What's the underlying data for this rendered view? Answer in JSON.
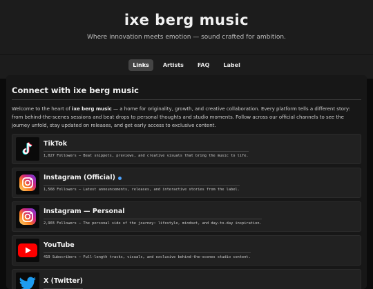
{
  "header": {
    "title": "ixe berg music",
    "tagline": "Where innovation meets emotion — sound crafted for ambition."
  },
  "nav": {
    "items": [
      {
        "label": "Links",
        "active": true
      },
      {
        "label": "Artists",
        "active": false
      },
      {
        "label": "FAQ",
        "active": false
      },
      {
        "label": "Label",
        "active": false
      }
    ]
  },
  "main": {
    "title": "Connect with ixe berg music",
    "intro_prefix": "Welcome to the heart of ",
    "intro_bold": "ixe berg music",
    "intro_rest": " — a home for originality, growth, and creative collaboration. Every platform tells a different story: from behind-the-scenes sessions and beat drops to personal thoughts and studio moments. Follow across our official channels to see the journey unfold, stay updated on releases, and get early access to exclusive content.",
    "links": [
      {
        "name": "TikTok",
        "icon": "tiktok-icon",
        "verified": false,
        "desc": "1,027 Followers — Beat snippets, previews, and creative visuals that bring the music to life."
      },
      {
        "name": "Instagram (Official)",
        "icon": "instagram-icon",
        "verified": true,
        "desc": "1,568 Followers — Latest announcements, releases, and interactive stories from the label."
      },
      {
        "name": "Instagram — Personal",
        "icon": "instagram-icon",
        "verified": false,
        "desc": "2,903 Followers — The personal side of the journey: lifestyle, mindset, and day-to-day inspiration."
      },
      {
        "name": "YouTube",
        "icon": "youtube-icon",
        "verified": false,
        "desc": "419 Subscribers — Full-length tracks, visuals, and exclusive behind-the-scenes studio content."
      },
      {
        "name": "X (Twitter)",
        "icon": "twitter-icon",
        "verified": false,
        "desc": ""
      }
    ]
  },
  "colors": {
    "background": "#0b0b0b",
    "header": "#1c1c1c",
    "panel": "#171717",
    "card": "#212121",
    "verified": "#4da3ff",
    "youtube": "#ff0000",
    "twitter": "#1d9bf0"
  }
}
